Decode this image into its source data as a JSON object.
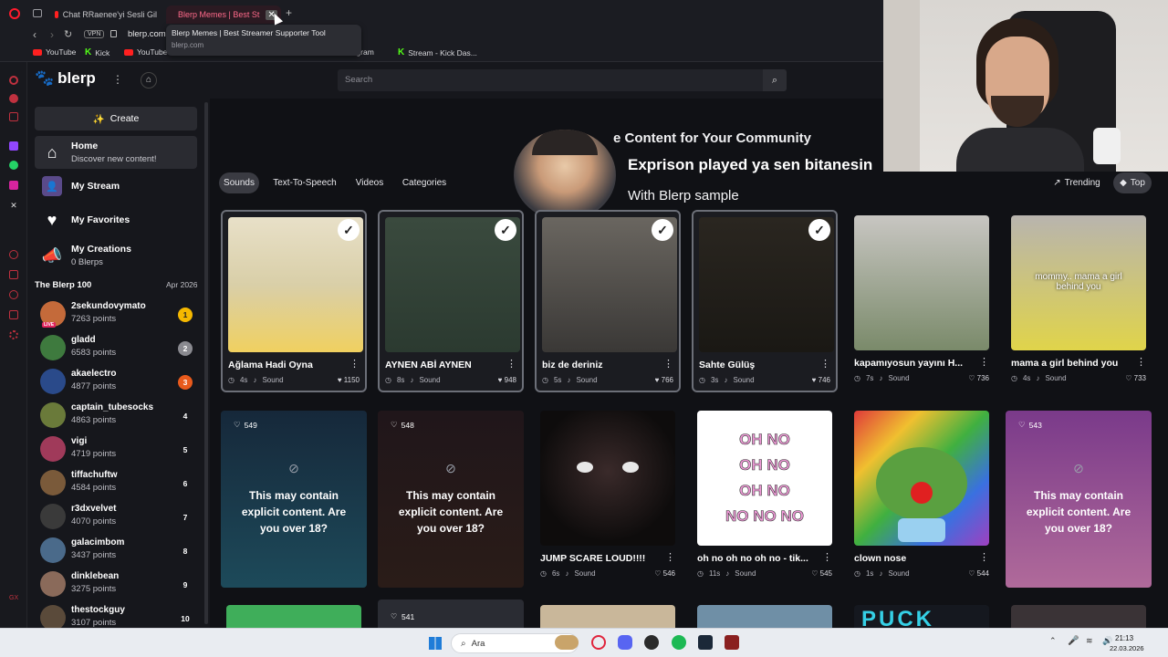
{
  "browser": {
    "tabs": [
      {
        "label": "Chat RRaenee'yi Sesli Gil"
      },
      {
        "label": "Blerp Memes | Best St"
      }
    ],
    "new_tab": "+",
    "address": "blerp.com",
    "vpn": "VPN",
    "tooltip_title": "Blerp Memes | Best Streamer Supporter Tool",
    "tooltip_url": "blerp.com",
    "bookmarks": [
      "YouTube",
      "Kick",
      "YouTube",
      "Instagram",
      "Stream - Kick Das..."
    ]
  },
  "header": {
    "logo": "blerp",
    "search_placeholder": "Search"
  },
  "sidebar": {
    "create_label": "Create",
    "nav": [
      {
        "title": "Home",
        "subtitle": "Discover new content!"
      },
      {
        "title": "My Stream",
        "subtitle": ""
      },
      {
        "title": "My Favorites",
        "subtitle": ""
      },
      {
        "title": "My Creations",
        "subtitle": "0 Blerps"
      }
    ],
    "leaderboard_title": "The Blerp 100",
    "leaderboard_date": "Apr 2026",
    "live_badge": "LIVE",
    "leaderboard": [
      {
        "name": "2sekundovymato",
        "points": "7263 points",
        "rank": "1"
      },
      {
        "name": "gladd",
        "points": "6583 points",
        "rank": "2"
      },
      {
        "name": "akaelectro",
        "points": "4877 points",
        "rank": "3"
      },
      {
        "name": "captain_tubesocks",
        "points": "4863 points",
        "rank": "4"
      },
      {
        "name": "vigi",
        "points": "4719 points",
        "rank": "5"
      },
      {
        "name": "tiffachuftw",
        "points": "4584 points",
        "rank": "6"
      },
      {
        "name": "r3dxvelvet",
        "points": "4070 points",
        "rank": "7"
      },
      {
        "name": "galacimbom",
        "points": "3437 points",
        "rank": "8"
      },
      {
        "name": "dinklebean",
        "points": "3275 points",
        "rank": "9"
      },
      {
        "name": "thestockguy",
        "points": "3107 points",
        "rank": "10"
      }
    ]
  },
  "main": {
    "banner_heading": "e Content for Your Community",
    "overlay_line1": "Exprison played ya sen bitanesin",
    "overlay_line2": "With Blerp sample",
    "filters": [
      "Sounds",
      "Text-To-Speech",
      "Videos",
      "Categories"
    ],
    "sort": [
      "Trending",
      "Top"
    ],
    "row1": [
      {
        "title": "Ağlama Hadi Oyna",
        "duration": "4s",
        "type": "Sound",
        "likes": "1150",
        "selected": true
      },
      {
        "title": "AYNEN ABİ AYNEN",
        "duration": "8s",
        "type": "Sound",
        "likes": "948",
        "selected": true
      },
      {
        "title": "biz de deriniz",
        "duration": "5s",
        "type": "Sound",
        "likes": "766",
        "selected": true
      },
      {
        "title": "Sahte Gülüş",
        "duration": "3s",
        "type": "Sound",
        "likes": "746",
        "selected": true
      },
      {
        "title": "kapamıyosun yayını H...",
        "duration": "7s",
        "type": "Sound",
        "likes": "736",
        "selected": false
      },
      {
        "title": "mama a girl behind you",
        "duration": "4s",
        "type": "Sound",
        "likes": "733",
        "selected": false
      }
    ],
    "thumb_caption": "mommy.. mama a girl behind you",
    "explicit_msg": "This may contain explicit content. Are you over 18?",
    "row2": [
      {
        "kind": "explicit",
        "likes": "549"
      },
      {
        "kind": "explicit",
        "likes": "548"
      },
      {
        "kind": "card",
        "title": "JUMP SCARE LOUD!!!!",
        "duration": "6s",
        "type": "Sound",
        "likes": "546"
      },
      {
        "kind": "card",
        "title": "oh no oh no oh no - tik...",
        "duration": "11s",
        "type": "Sound",
        "likes": "545"
      },
      {
        "kind": "card",
        "title": "clown nose",
        "duration": "1s",
        "type": "Sound",
        "likes": "544"
      },
      {
        "kind": "explicit",
        "likes": "543"
      }
    ],
    "ohno_text": [
      "OH NO",
      "OH NO",
      "OH NO",
      "NO NO NO"
    ],
    "row3_likes": "541",
    "row3_partial_text": "PUCK"
  },
  "taskbar": {
    "search_label": "Ara",
    "time": "21:13",
    "date": "22.03.2026"
  },
  "colors": {
    "accent_rank1": "#f5b800",
    "accent_rank3": "#e85a1c",
    "live": "#e0245e"
  }
}
